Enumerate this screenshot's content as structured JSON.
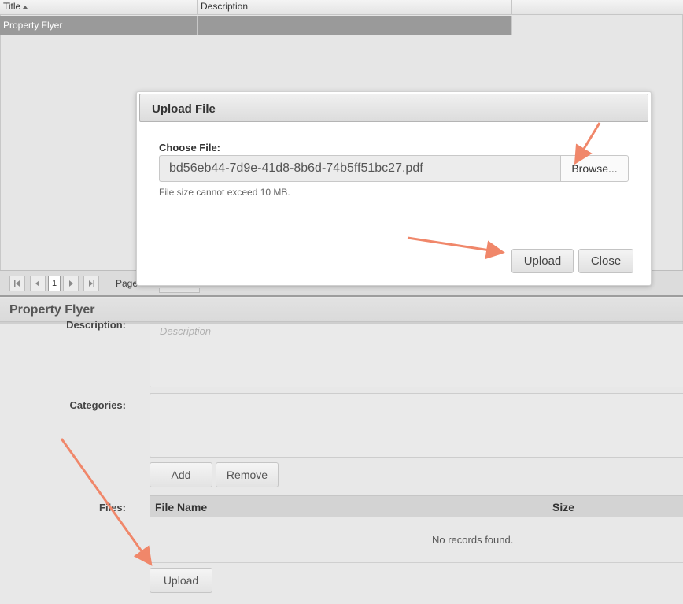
{
  "grid": {
    "columns": [
      {
        "label": "Title",
        "sort": "ascending"
      },
      {
        "label": "Description"
      }
    ],
    "rows": [
      {
        "title": "Property Flyer",
        "description": ""
      }
    ],
    "pager": {
      "current_page": "1",
      "page_label": "Page"
    }
  },
  "details": {
    "title": "Property Flyer",
    "description_label": "Description:",
    "description_placeholder": "Description",
    "categories_label": "Categories:",
    "add_label": "Add",
    "remove_label": "Remove",
    "files_label": "Files:",
    "files_table": {
      "columns": [
        "File Name",
        "Size"
      ],
      "empty_text": "No records found."
    },
    "upload_label": "Upload"
  },
  "modal": {
    "title": "Upload File",
    "choose_label": "Choose File:",
    "file_value": "bd56eb44-7d9e-41d8-8b6d-74b5ff51bc27.pdf",
    "browse_label": "Browse...",
    "hint": "File size cannot exceed 10 MB.",
    "upload_label": "Upload",
    "close_label": "Close"
  },
  "annotations": {
    "arrow_color": "#f0876a"
  }
}
